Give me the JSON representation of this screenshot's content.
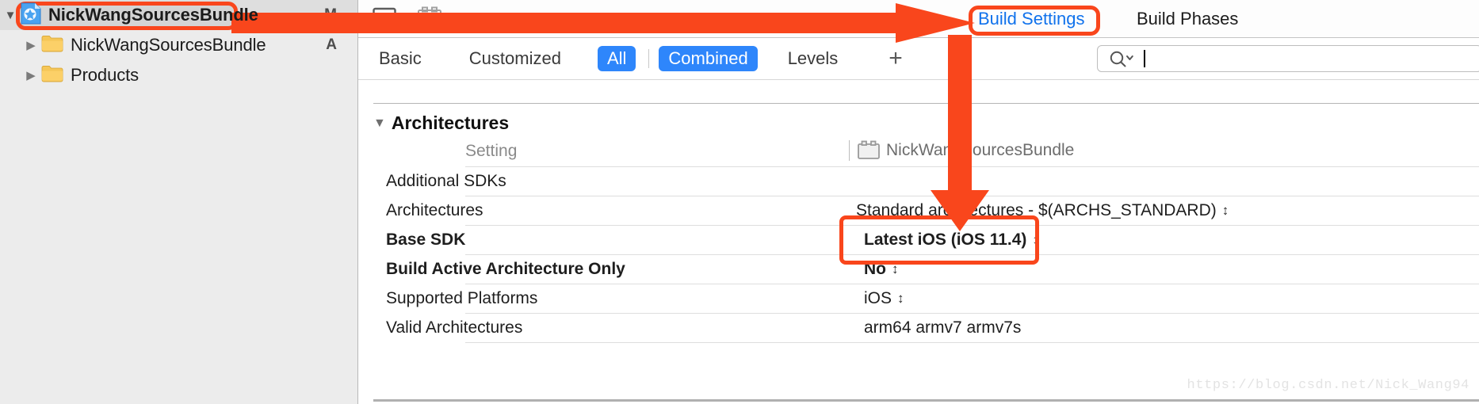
{
  "navigator": {
    "rows": [
      {
        "label": "NickWangSourcesBundle",
        "icon": "xcode-project-icon",
        "status": "M",
        "selected": true,
        "expanded": true,
        "indent": 0
      },
      {
        "label": "NickWangSourcesBundle",
        "icon": "folder-icon",
        "status": "A",
        "selected": false,
        "expanded": false,
        "indent": 1
      },
      {
        "label": "Products",
        "icon": "folder-icon",
        "status": "",
        "selected": false,
        "expanded": false,
        "indent": 1
      }
    ]
  },
  "editor": {
    "tabs": [
      {
        "label": "Build Settings",
        "active": true
      },
      {
        "label": "Build Phases",
        "active": false
      }
    ],
    "toolbar_icons": [
      "panel-toggle-icon",
      "target-icon"
    ],
    "filters": [
      {
        "label": "Basic",
        "selected": false
      },
      {
        "label": "Customized",
        "selected": false
      },
      {
        "label": "All",
        "selected": true
      },
      {
        "label": "Combined",
        "selected": true
      },
      {
        "label": "Levels",
        "selected": false
      }
    ],
    "add_button": "+",
    "search": {
      "placeholder": "",
      "value": "",
      "icon": "search-icon"
    }
  },
  "settings": {
    "group_title": "Architectures",
    "group_expanded": true,
    "columns": {
      "setting": "Setting",
      "target": "NickWangSourcesBundle",
      "target_icon": "target-bundle-icon"
    },
    "rows": [
      {
        "name": "Additional SDKs",
        "value": "",
        "bold": false,
        "stepper": false
      },
      {
        "name": "Architectures",
        "value": "Standard architectures  -  $(ARCHS_STANDARD)",
        "bold": false,
        "stepper": true
      },
      {
        "name": "Base SDK",
        "value": "Latest iOS (iOS 11.4)",
        "bold": true,
        "stepper": true
      },
      {
        "name": "Build Active Architecture Only",
        "value": "No",
        "bold": true,
        "stepper": true
      },
      {
        "name": "Supported Platforms",
        "value": "iOS",
        "bold": false,
        "stepper": true
      },
      {
        "name": "Valid Architectures",
        "value": "arm64 armv7 armv7s",
        "bold": false,
        "stepper": false
      }
    ]
  },
  "watermark": "https://blog.csdn.net/Nick_Wang94",
  "annotation": {
    "color": "#f9461c",
    "highlights": [
      "project-row-highlight",
      "build-settings-tab-highlight",
      "sdk-values-highlight"
    ],
    "arrows": [
      "horizontal-arrow-to-build-settings",
      "vertical-arrow-to-base-sdk"
    ]
  }
}
